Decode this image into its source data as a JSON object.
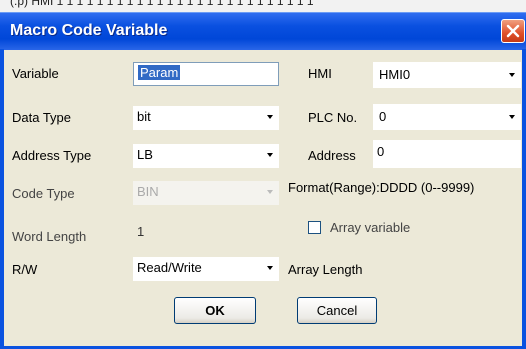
{
  "top_strip_text": "(.p) HMI 1 1 1 1 1 1 1 1 1 1 1 1 1 1 1 1 1 1 1 1 1 1 1 1 1 1",
  "window": {
    "title": "Macro Code Variable"
  },
  "form": {
    "variable": {
      "label": "Variable",
      "value": "Param"
    },
    "data_type": {
      "label": "Data Type",
      "value": "bit"
    },
    "address_type": {
      "label": "Address Type",
      "value": "LB"
    },
    "code_type": {
      "label": "Code Type",
      "value": "BIN"
    },
    "word_length": {
      "label": "Word Length",
      "value": "1"
    },
    "rw": {
      "label": "R/W",
      "value": "Read/Write"
    },
    "hmi": {
      "label": "HMI",
      "value": "HMI0"
    },
    "plc_no": {
      "label": "PLC No.",
      "value": "0"
    },
    "address": {
      "label": "Address",
      "value": "0"
    },
    "format_range": "Format(Range):DDDD (0--9999)",
    "array_variable": {
      "label": "Array variable",
      "checked": false
    },
    "array_length": {
      "label": "Array Length",
      "value": ""
    }
  },
  "buttons": {
    "ok": "OK",
    "cancel": "Cancel"
  }
}
